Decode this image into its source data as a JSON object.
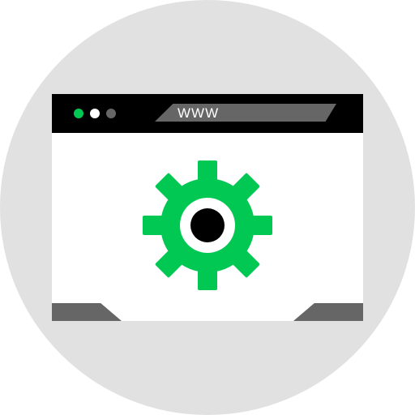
{
  "browser": {
    "url_text": "WWW"
  },
  "icons": {
    "window": "browser-window-icon",
    "settings": "gear-icon"
  },
  "colors": {
    "background_circle": "#e1e1e1",
    "titlebar": "#000000",
    "urlbar": "#666666",
    "url_text": "#ffffff",
    "dot_1": "#00c853",
    "dot_2": "#ffffff",
    "dot_3": "#666666",
    "content": "#ffffff",
    "gear": "#00c853",
    "gear_ring": "#ffffff",
    "gear_center": "#000000",
    "corners": "#666666"
  }
}
